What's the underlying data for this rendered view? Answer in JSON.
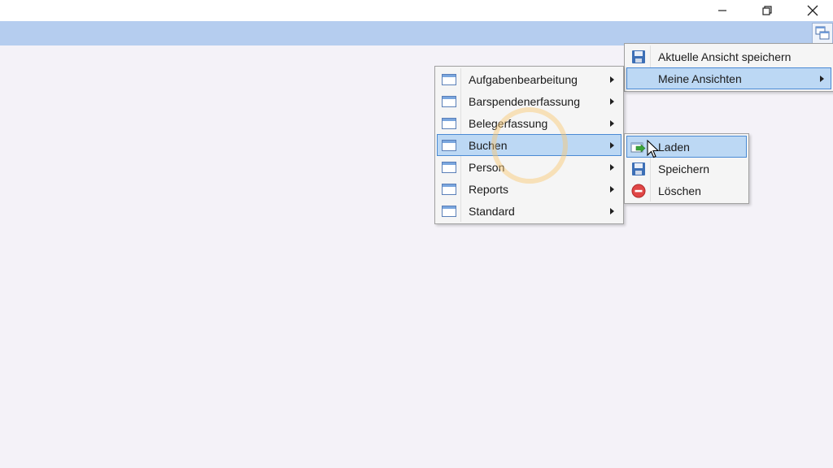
{
  "window": {
    "minimize_icon": "minimize-icon",
    "restore_icon": "restore-icon",
    "close_icon": "close-icon"
  },
  "colors": {
    "ribbon": "#b5cdef",
    "menu_highlight": "#bcd8f4",
    "menu_highlight_border": "#4a8ad4",
    "background": "#f4f2f8"
  },
  "main_menu": {
    "items": [
      {
        "label": "Aktuelle Ansicht speichern",
        "icon": "floppy-disk-icon",
        "has_submenu": false,
        "active": false
      },
      {
        "label": "Meine Ansichten",
        "icon": "",
        "has_submenu": true,
        "active": true
      }
    ]
  },
  "views_menu": {
    "items": [
      {
        "label": "Aufgabenbearbeitung",
        "icon": "window-icon",
        "has_submenu": true,
        "active": false
      },
      {
        "label": "Barspendenerfassung",
        "icon": "window-icon",
        "has_submenu": true,
        "active": false
      },
      {
        "label": "Belegerfassung",
        "icon": "window-icon",
        "has_submenu": true,
        "active": false
      },
      {
        "label": "Buchen",
        "icon": "window-icon",
        "has_submenu": true,
        "active": true
      },
      {
        "label": "Person",
        "icon": "window-icon",
        "has_submenu": true,
        "active": false
      },
      {
        "label": "Reports",
        "icon": "window-icon",
        "has_submenu": true,
        "active": false
      },
      {
        "label": "Standard",
        "icon": "window-icon",
        "has_submenu": true,
        "active": false
      }
    ]
  },
  "actions_menu": {
    "items": [
      {
        "label": "Laden",
        "icon": "load-arrow-icon",
        "active": true
      },
      {
        "label": "Speichern",
        "icon": "floppy-disk-icon",
        "active": false
      },
      {
        "label": "Löschen",
        "icon": "delete-icon",
        "active": false
      }
    ]
  }
}
